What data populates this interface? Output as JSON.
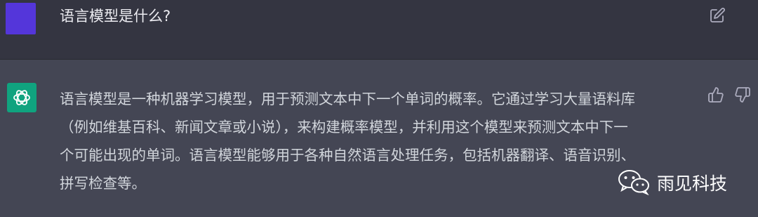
{
  "user_message": {
    "text": "语言模型是什么?"
  },
  "assistant_message": {
    "lines": [
      "语言模型是一种机器学习模型，用于预测文本中下一个单词的概率。它通过学习大量语料库",
      "（例如维基百科、新闻文章或小说），来构建概率模型，并利用这个模型来预测文本中下一",
      "个可能出现的单词。语言模型能够用于各种自然语言处理任务，包括机器翻译、语音识别、",
      "拼写检查等。"
    ]
  },
  "watermark": {
    "text": "雨见科技"
  },
  "icons": {
    "edit": "edit-icon",
    "thumbs_up": "thumbs-up-icon",
    "thumbs_down": "thumbs-down-icon",
    "openai_logo": "openai-logo-icon",
    "wechat": "wechat-icon"
  },
  "colors": {
    "user_bg": "#343541",
    "assistant_bg": "#444654",
    "user_avatar": "#5436da",
    "bot_avatar": "#10a37f",
    "text": "#d1d5db"
  }
}
